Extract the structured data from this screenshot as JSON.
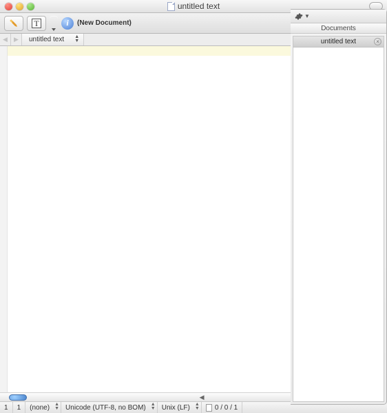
{
  "window": {
    "title": "untitled text"
  },
  "toolbar": {
    "subtitle": "(New Document)",
    "info_glyph": "i",
    "textmode_glyph": "T",
    "drawer_toggle_glyph": "◧"
  },
  "tabs": {
    "items": [
      {
        "label": "untitled text"
      }
    ]
  },
  "status": {
    "line": "1",
    "col": "1",
    "language": "(none)",
    "encoding": "Unicode (UTF-8, no BOM)",
    "line_endings": "Unix (LF)",
    "position": "0 / 0 / 1"
  },
  "drawer": {
    "header": "Documents",
    "items": [
      {
        "label": "untitled text"
      }
    ]
  }
}
